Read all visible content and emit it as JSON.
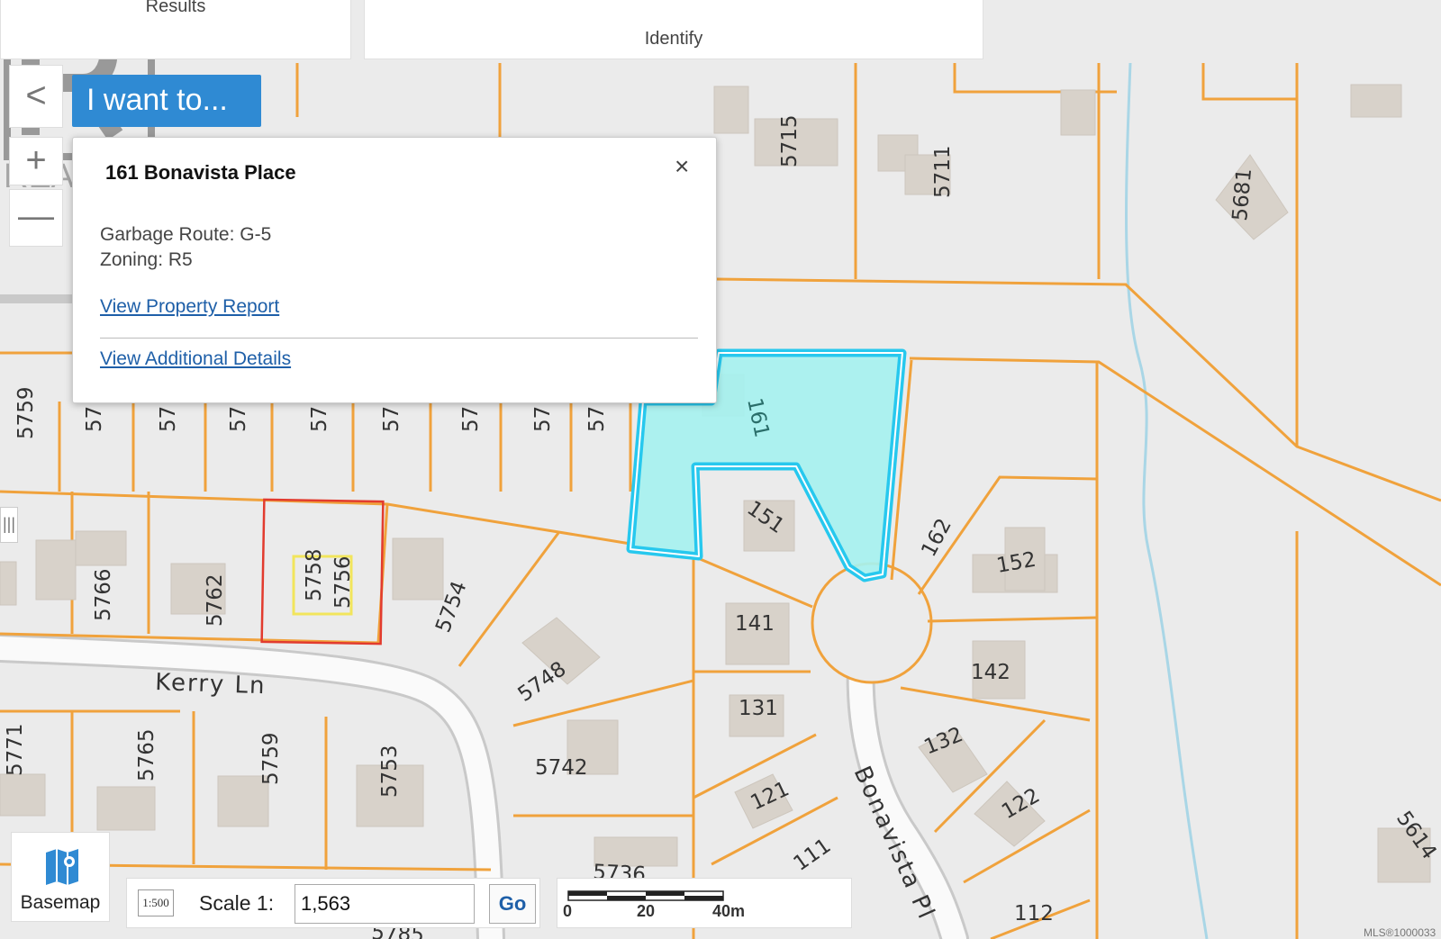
{
  "tabs": {
    "results": "Results",
    "identify": "Identify"
  },
  "watermark": "REALTOR",
  "controls": {
    "collapse": "<",
    "zoom_in": "+",
    "zoom_out": "—"
  },
  "iwant": "I want to...",
  "popup": {
    "title": "161 Bonavista Place",
    "close": "×",
    "garbage": "Garbage Route: G-5",
    "zoning": "Zoning: R5",
    "link_report": "View Property Report",
    "link_details": "View Additional Details"
  },
  "basemap": {
    "label": "Basemap",
    "icon": "basemap-icon"
  },
  "scale": {
    "icon_text": "1:500",
    "label": "Scale 1:",
    "value": "1,563",
    "go": "Go"
  },
  "ruler": {
    "t0": "0",
    "t1": "20",
    "t2": "40m"
  },
  "footer": {
    "mls": "MLS®1000033"
  },
  "map": {
    "streets": [
      "Kerry Ln",
      "Bonavista Pl"
    ],
    "highlight_color": "#a6f1ef",
    "outline_color": "#27c8ee",
    "lot_line_color": "#f0a23c",
    "selected_lot_color": "#e23b2e",
    "lot_numbers": [
      "5715",
      "5711",
      "5681",
      "5759",
      "57",
      "57",
      "57",
      "57",
      "57",
      "57",
      "57",
      "57",
      "161",
      "151",
      "162",
      "152",
      "5766",
      "5762",
      "5758",
      "5756",
      "5754",
      "141",
      "142",
      "5748",
      "131",
      "132",
      "5771",
      "5765",
      "5759",
      "5753",
      "5742",
      "121",
      "122",
      "111",
      "5736",
      "112",
      "5614",
      "5785"
    ]
  }
}
